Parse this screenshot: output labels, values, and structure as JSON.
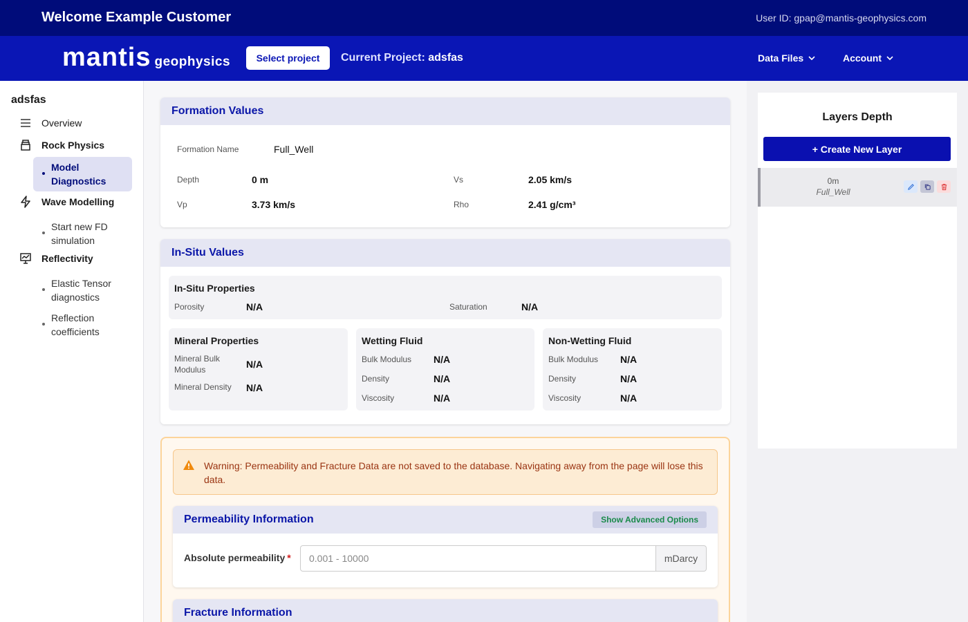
{
  "header": {
    "welcome": "Welcome Example Customer",
    "user_id": "User ID: gpap@mantis-geophysics.com"
  },
  "nav": {
    "logo_main": "mantis",
    "logo_sub": "geophysics",
    "select_project": "Select project",
    "current_project_label": "Current Project:",
    "current_project_name": "adsfas",
    "data_files": "Data Files",
    "account": "Account"
  },
  "sidebar": {
    "project": "adsfas",
    "overview": "Overview",
    "rock_physics": "Rock Physics",
    "model_diagnostics": "Model Diagnostics",
    "wave_modelling": "Wave Modelling",
    "start_fd": "Start new FD simulation",
    "reflectivity": "Reflectivity",
    "elastic_tensor": "Elastic Tensor diagnostics",
    "reflection_coeff": "Reflection coefficients"
  },
  "formation": {
    "title": "Formation Values",
    "name_label": "Formation Name",
    "name_value": "Full_Well",
    "depth_label": "Depth",
    "depth_value": "0 m",
    "vs_label": "Vs",
    "vs_value": "2.05 km/s",
    "vp_label": "Vp",
    "vp_value": "3.73 km/s",
    "rho_label": "Rho",
    "rho_value": "2.41 g/cm³"
  },
  "insitu": {
    "title": "In-Situ Values",
    "props_title": "In-Situ Properties",
    "porosity_label": "Porosity",
    "porosity_value": "N/A",
    "saturation_label": "Saturation",
    "saturation_value": "N/A",
    "mineral_title": "Mineral Properties",
    "mineral_bulk_label": "Mineral Bulk Modulus",
    "mineral_bulk_value": "N/A",
    "mineral_density_label": "Mineral Density",
    "mineral_density_value": "N/A",
    "wetting_title": "Wetting Fluid",
    "wetting_bulk_label": "Bulk Modulus",
    "wetting_bulk_value": "N/A",
    "wetting_density_label": "Density",
    "wetting_density_value": "N/A",
    "wetting_visc_label": "Viscosity",
    "wetting_visc_value": "N/A",
    "nonwetting_title": "Non-Wetting Fluid",
    "nonwetting_bulk_label": "Bulk Modulus",
    "nonwetting_bulk_value": "N/A",
    "nonwetting_density_label": "Density",
    "nonwetting_density_value": "N/A",
    "nonwetting_visc_label": "Viscosity",
    "nonwetting_visc_value": "N/A"
  },
  "warning": {
    "text": "Warning: Permeability and Fracture Data are not saved to the database. Navigating away from the page will lose this data."
  },
  "permeability": {
    "title": "Permeability Information",
    "advanced": "Show Advanced Options",
    "abs_label": "Absolute permeability",
    "required_mark": "*",
    "placeholder": "0.001 - 10000",
    "unit": "mDarcy"
  },
  "fracture": {
    "title": "Fracture Information"
  },
  "layers": {
    "title": "Layers Depth",
    "create": "+ Create New Layer",
    "items": [
      {
        "depth": "0m",
        "name": "Full_Well"
      }
    ]
  },
  "colors": {
    "top_bar": "#000c7a",
    "nav_bar": "#0a16b5",
    "accent": "#0a16a8",
    "warning_text": "#9a3412"
  }
}
